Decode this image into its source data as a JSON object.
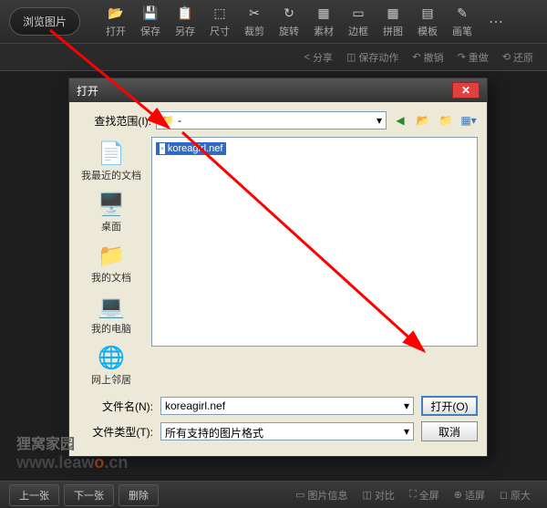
{
  "toolbar": {
    "browse": "浏览图片",
    "items": [
      {
        "icon": "📂",
        "label": "打开"
      },
      {
        "icon": "💾",
        "label": "保存"
      },
      {
        "icon": "📋",
        "label": "另存"
      },
      {
        "icon": "⬚",
        "label": "尺寸"
      },
      {
        "icon": "✂",
        "label": "裁剪"
      },
      {
        "icon": "↻",
        "label": "旋转"
      },
      {
        "icon": "▦",
        "label": "素材"
      },
      {
        "icon": "▭",
        "label": "边框"
      },
      {
        "icon": "▦",
        "label": "拼图"
      },
      {
        "icon": "▤",
        "label": "模板"
      },
      {
        "icon": "✎",
        "label": "画笔"
      }
    ]
  },
  "subbar": {
    "share": "分享",
    "save_action": "保存动作",
    "undo": "撤销",
    "redo": "重做",
    "restore": "还原"
  },
  "dialog": {
    "title": "打开",
    "lookup_label": "查找范围(I):",
    "current_folder": "-",
    "sidebar": [
      {
        "label": "我最近的文档"
      },
      {
        "label": "桌面"
      },
      {
        "label": "我的文档"
      },
      {
        "label": "我的电脑"
      },
      {
        "label": "网上邻居"
      }
    ],
    "selected_file": "koreagirl.nef",
    "filename_label": "文件名(N):",
    "filename_value": "koreagirl.nef",
    "filetype_label": "文件类型(T):",
    "filetype_value": "所有支持的图片格式",
    "open_btn": "打开(O)",
    "cancel_btn": "取消"
  },
  "watermark": {
    "cn": "狸窝家园",
    "en_pre": "www.leaw",
    "en_o": "o",
    "en_post": ".cn"
  },
  "bottom": {
    "prev": "上一张",
    "next": "下一张",
    "del": "删除",
    "info": "图片信息",
    "compare": "对比",
    "fullscreen": "全屏",
    "fit": "适屏",
    "orig": "原大"
  }
}
